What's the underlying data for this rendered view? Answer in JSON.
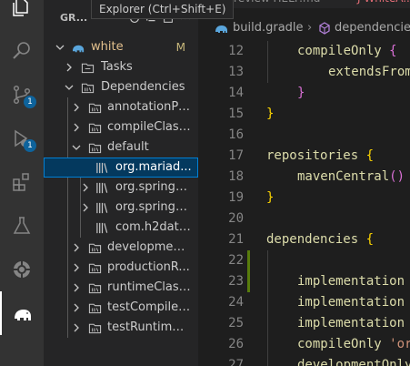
{
  "tooltip": "Explorer (Ctrl+Shift+E)",
  "activity": {
    "items": [
      "explorer-icon",
      "search-icon",
      "source-control-icon",
      "run-debug-icon",
      "extensions-icon",
      "testing-icon",
      "remote-icon",
      "gradle-elephant-icon"
    ],
    "badges": {
      "source_control": "1",
      "run_debug": "1"
    }
  },
  "sidebar": {
    "header_title": "GR...",
    "root": {
      "label": "white",
      "modified": "M"
    },
    "tree": [
      {
        "label": "Tasks"
      },
      {
        "label": "Dependencies"
      },
      {
        "label": "annotationPr..."
      },
      {
        "label": "compileClass..."
      },
      {
        "label": "default"
      },
      {
        "label": "org.mariad..."
      },
      {
        "label": "org.springfr..."
      },
      {
        "label": "org.springfr..."
      },
      {
        "label": "com.h2data..."
      },
      {
        "label": "development..."
      },
      {
        "label": "productionR..."
      },
      {
        "label": "runtimeClass..."
      },
      {
        "label": "testCompileC..."
      },
      {
        "label": "testRuntimeC..."
      }
    ]
  },
  "editor": {
    "tabs": [
      {
        "label": "Preview HELP.md"
      },
      {
        "label": "J  WhiteA..."
      }
    ],
    "breadcrumb": {
      "file": "build.gradle",
      "symbol": "dependencies"
    },
    "lines": [
      {
        "n": "12",
        "text": "compileOnly {"
      },
      {
        "n": "13",
        "text": "extendsFrom"
      },
      {
        "n": "14",
        "text": "}"
      },
      {
        "n": "15",
        "text": "}"
      },
      {
        "n": "16",
        "text": ""
      },
      {
        "n": "17",
        "text": "repositories {"
      },
      {
        "n": "18",
        "text": "mavenCentral()"
      },
      {
        "n": "19",
        "text": "}"
      },
      {
        "n": "20",
        "text": ""
      },
      {
        "n": "21",
        "text": "dependencies {"
      },
      {
        "n": "22",
        "text": ""
      },
      {
        "n": "23",
        "text": "implementation"
      },
      {
        "n": "24",
        "text": "implementation"
      },
      {
        "n": "25",
        "text": "implementation"
      },
      {
        "n": "26",
        "text": "compileOnly 'or"
      },
      {
        "n": "27",
        "text": "developmentOnly"
      }
    ]
  },
  "colors": {
    "accent": "#007fd4",
    "badge": "#0e639c",
    "modified": "#c9b97c",
    "git_added": "#587c0c"
  }
}
